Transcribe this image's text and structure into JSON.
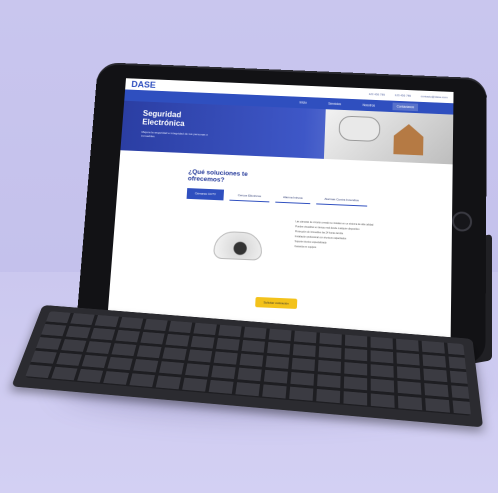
{
  "site": {
    "logo": "DASE",
    "contact": [
      "123 456 789",
      "123 456 789",
      "contacto@dase.com"
    ],
    "nav": [
      "Inicio",
      "Servicios",
      "Nosotros",
      "Contáctanos"
    ],
    "hero_title": "Seguridad Electrónica",
    "hero_subtitle": "Mejora la seguridad e integridad de tus personas e inmuebles",
    "solutions_title": "¿Qué soluciones te ofrecemos?",
    "tabs": [
      "Cámaras CCTV",
      "Cercos Eléctricos",
      "Alarma Intrusa",
      "Alarmas Contra Incendios"
    ],
    "active_tab": 0,
    "bullets": [
      "Las cámaras de circuito cerrado se instalan en un sistema de alta calidad",
      "Puedes visualizar en tiempo real desde cualquier dispositivo",
      "Protección de inmuebles las 24 horas del día",
      "Instalación profesional con técnicos capacitados",
      "Soporte técnico especializado",
      "Garantía en equipos"
    ],
    "cta": "Solicitar cotización"
  },
  "colors": {
    "primary": "#2f4fbf",
    "accent": "#f3c21b",
    "background": "#c9c6ee"
  }
}
